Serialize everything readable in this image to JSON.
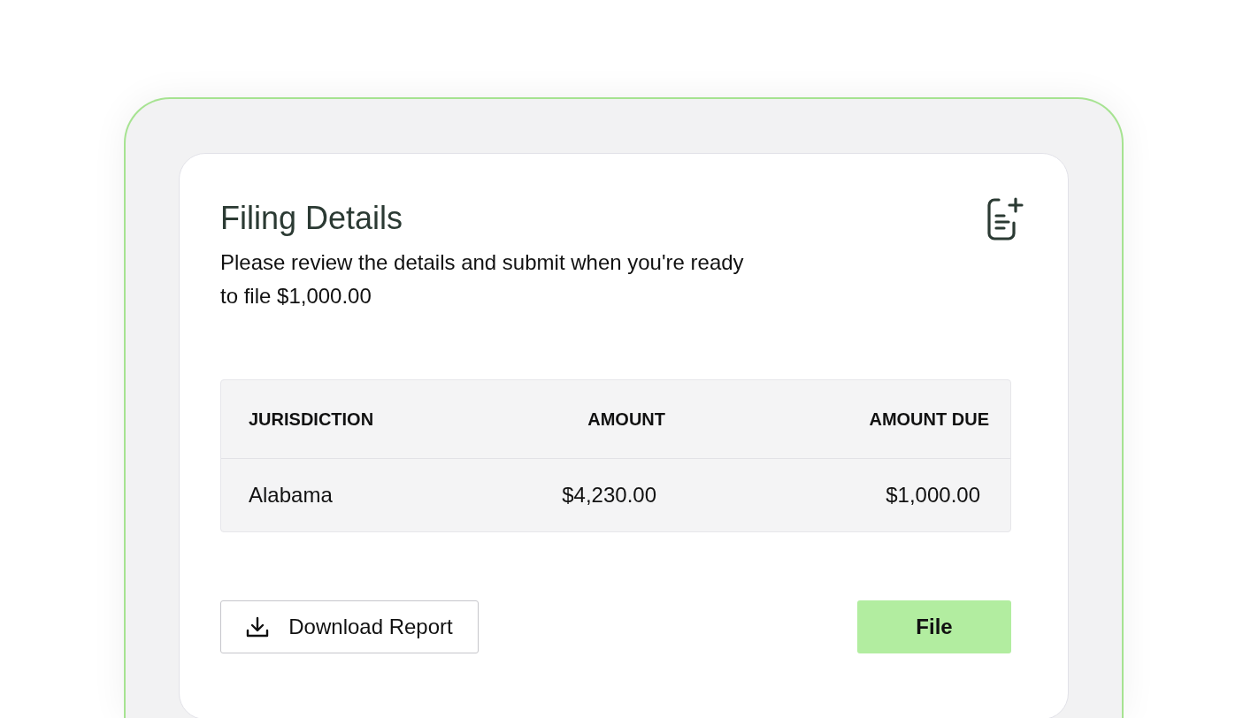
{
  "card": {
    "title": "Filing Details",
    "description": "Please review the details and submit when you're ready to file $1,000.00"
  },
  "table": {
    "columns": [
      "JURISDICTION",
      "AMOUNT",
      "AMOUNT DUE"
    ],
    "rows": [
      [
        "Alabama",
        "$4,230.00",
        "$1,000.00"
      ]
    ]
  },
  "actions": [
    {
      "kind": "secondary",
      "label": "Download Report"
    },
    {
      "kind": "primary",
      "label": "File"
    }
  ]
}
